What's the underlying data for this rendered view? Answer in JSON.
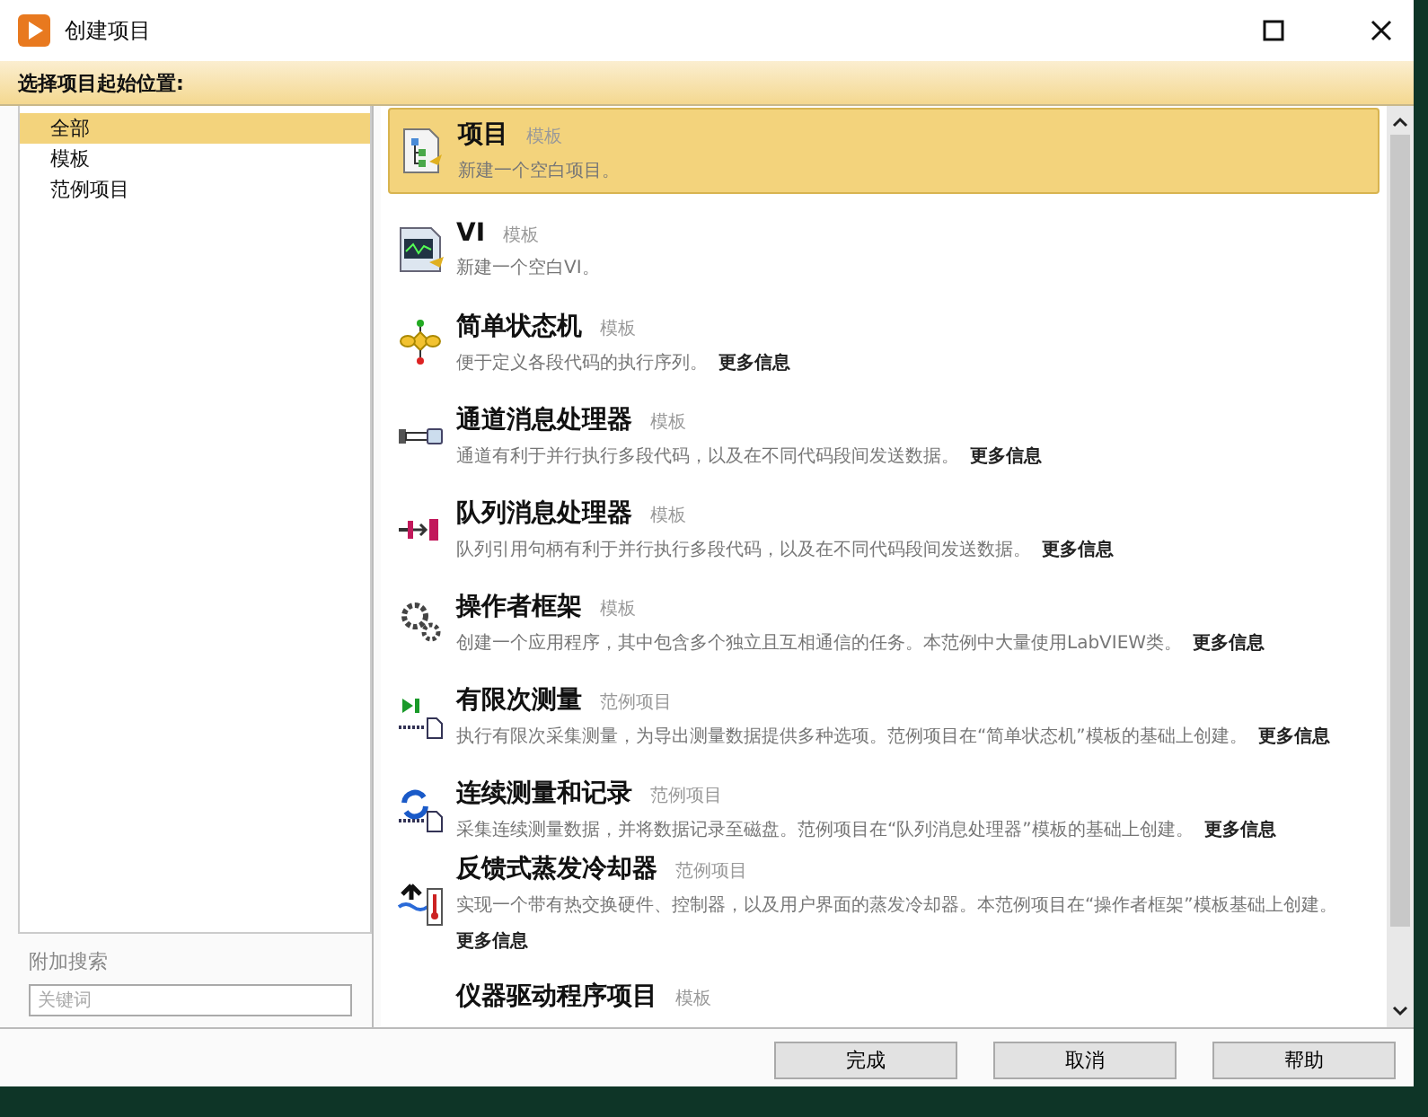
{
  "window": {
    "title": "创建项目"
  },
  "header": "选择项目起始位置:",
  "sidebar": {
    "items": [
      {
        "label": "全部",
        "selected": true
      },
      {
        "label": "模板",
        "selected": false
      },
      {
        "label": "范例项目",
        "selected": false
      }
    ],
    "search": {
      "label": "附加搜索",
      "placeholder": "关键词"
    }
  },
  "items": [
    {
      "kind": "project",
      "title": "项目",
      "tag": "模板",
      "description": "新建一个空白项目。",
      "selected": true
    },
    {
      "kind": "vi",
      "title": "VI",
      "tag": "模板",
      "description": "新建一个空白VI。",
      "selected": false
    },
    {
      "kind": "state-machine",
      "title": "简单状态机",
      "tag": "模板",
      "description": "便于定义各段代码的执行序列。",
      "more": "更多信息",
      "selected": false
    },
    {
      "kind": "channel",
      "title": "通道消息处理器",
      "tag": "模板",
      "description": "通道有利于并行执行多段代码，以及在不同代码段间发送数据。",
      "more": "更多信息",
      "selected": false
    },
    {
      "kind": "queue",
      "title": "队列消息处理器",
      "tag": "模板",
      "description": "队列引用句柄有利于并行执行多段代码，以及在不同代码段间发送数据。",
      "more": "更多信息",
      "selected": false
    },
    {
      "kind": "actor",
      "title": "操作者框架",
      "tag": "模板",
      "description": "创建一个应用程序，其中包含多个独立且互相通信的任务。本范例中大量使用LabVIEW类。",
      "more": "更多信息",
      "selected": false
    },
    {
      "kind": "finite",
      "title": "有限次测量",
      "tag": "范例项目",
      "description": "执行有限次采集测量，为导出测量数据提供多种选项。范例项目在“简单状态机”模板的基础上创建。",
      "more": "更多信息",
      "selected": false
    },
    {
      "kind": "continuous",
      "title": "连续测量和记录",
      "tag": "范例项目",
      "description": "采集连续测量数据，并将数据记录至磁盘。范例项目在“队列消息处理器”模板的基础上创建。",
      "more": "更多信息",
      "selected": false
    },
    {
      "kind": "cooler",
      "title": "反馈式蒸发冷却器",
      "tag": "范例项目",
      "description": "实现一个带有热交换硬件、控制器，以及用户界面的蒸发冷却器。本范例项目在“操作者框架”模板基础上创建。",
      "more": "更多信息",
      "selected": false
    },
    {
      "kind": "none",
      "title": "仪器驱动程序项目",
      "tag": "模板",
      "selected": false
    }
  ],
  "buttons": [
    "完成",
    "取消",
    "帮助"
  ]
}
